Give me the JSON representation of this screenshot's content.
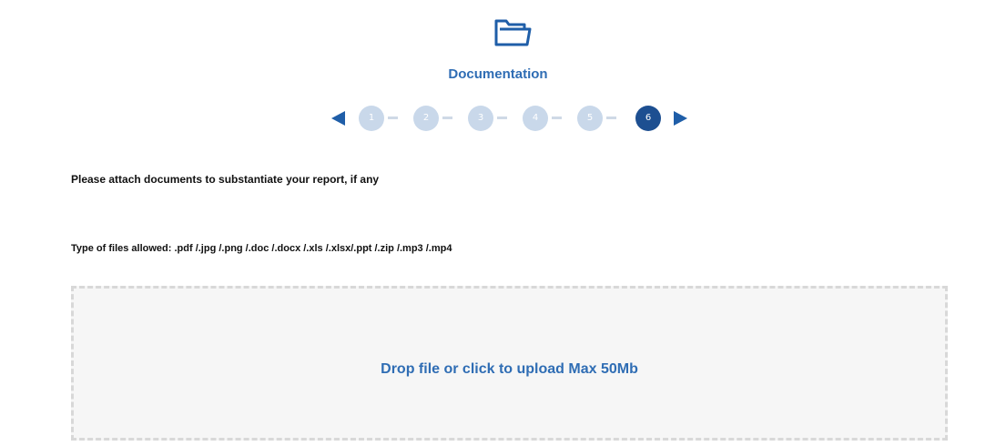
{
  "section": {
    "icon": "folder-icon",
    "title": "Documentation"
  },
  "stepper": {
    "prev_icon": "arrow-left-icon",
    "next_icon": "arrow-right-icon",
    "steps": [
      "1",
      "2",
      "3",
      "4",
      "5",
      "6"
    ],
    "active_step": "6",
    "colors": {
      "active": "#1d4f91",
      "inactive": "#c9d8ea",
      "arrow": "#1f5ea8"
    }
  },
  "form": {
    "instruction": "Please attach documents to substantiate your report, if any",
    "file_types": "Type of files allowed: .pdf /.jpg /.png /.doc /.docx /.xls /.xlsx/.ppt /.zip /.mp3 /.mp4",
    "dropzone_label": "Drop file or click to upload Max 50Mb"
  },
  "colors": {
    "accent": "#2f6db4"
  }
}
